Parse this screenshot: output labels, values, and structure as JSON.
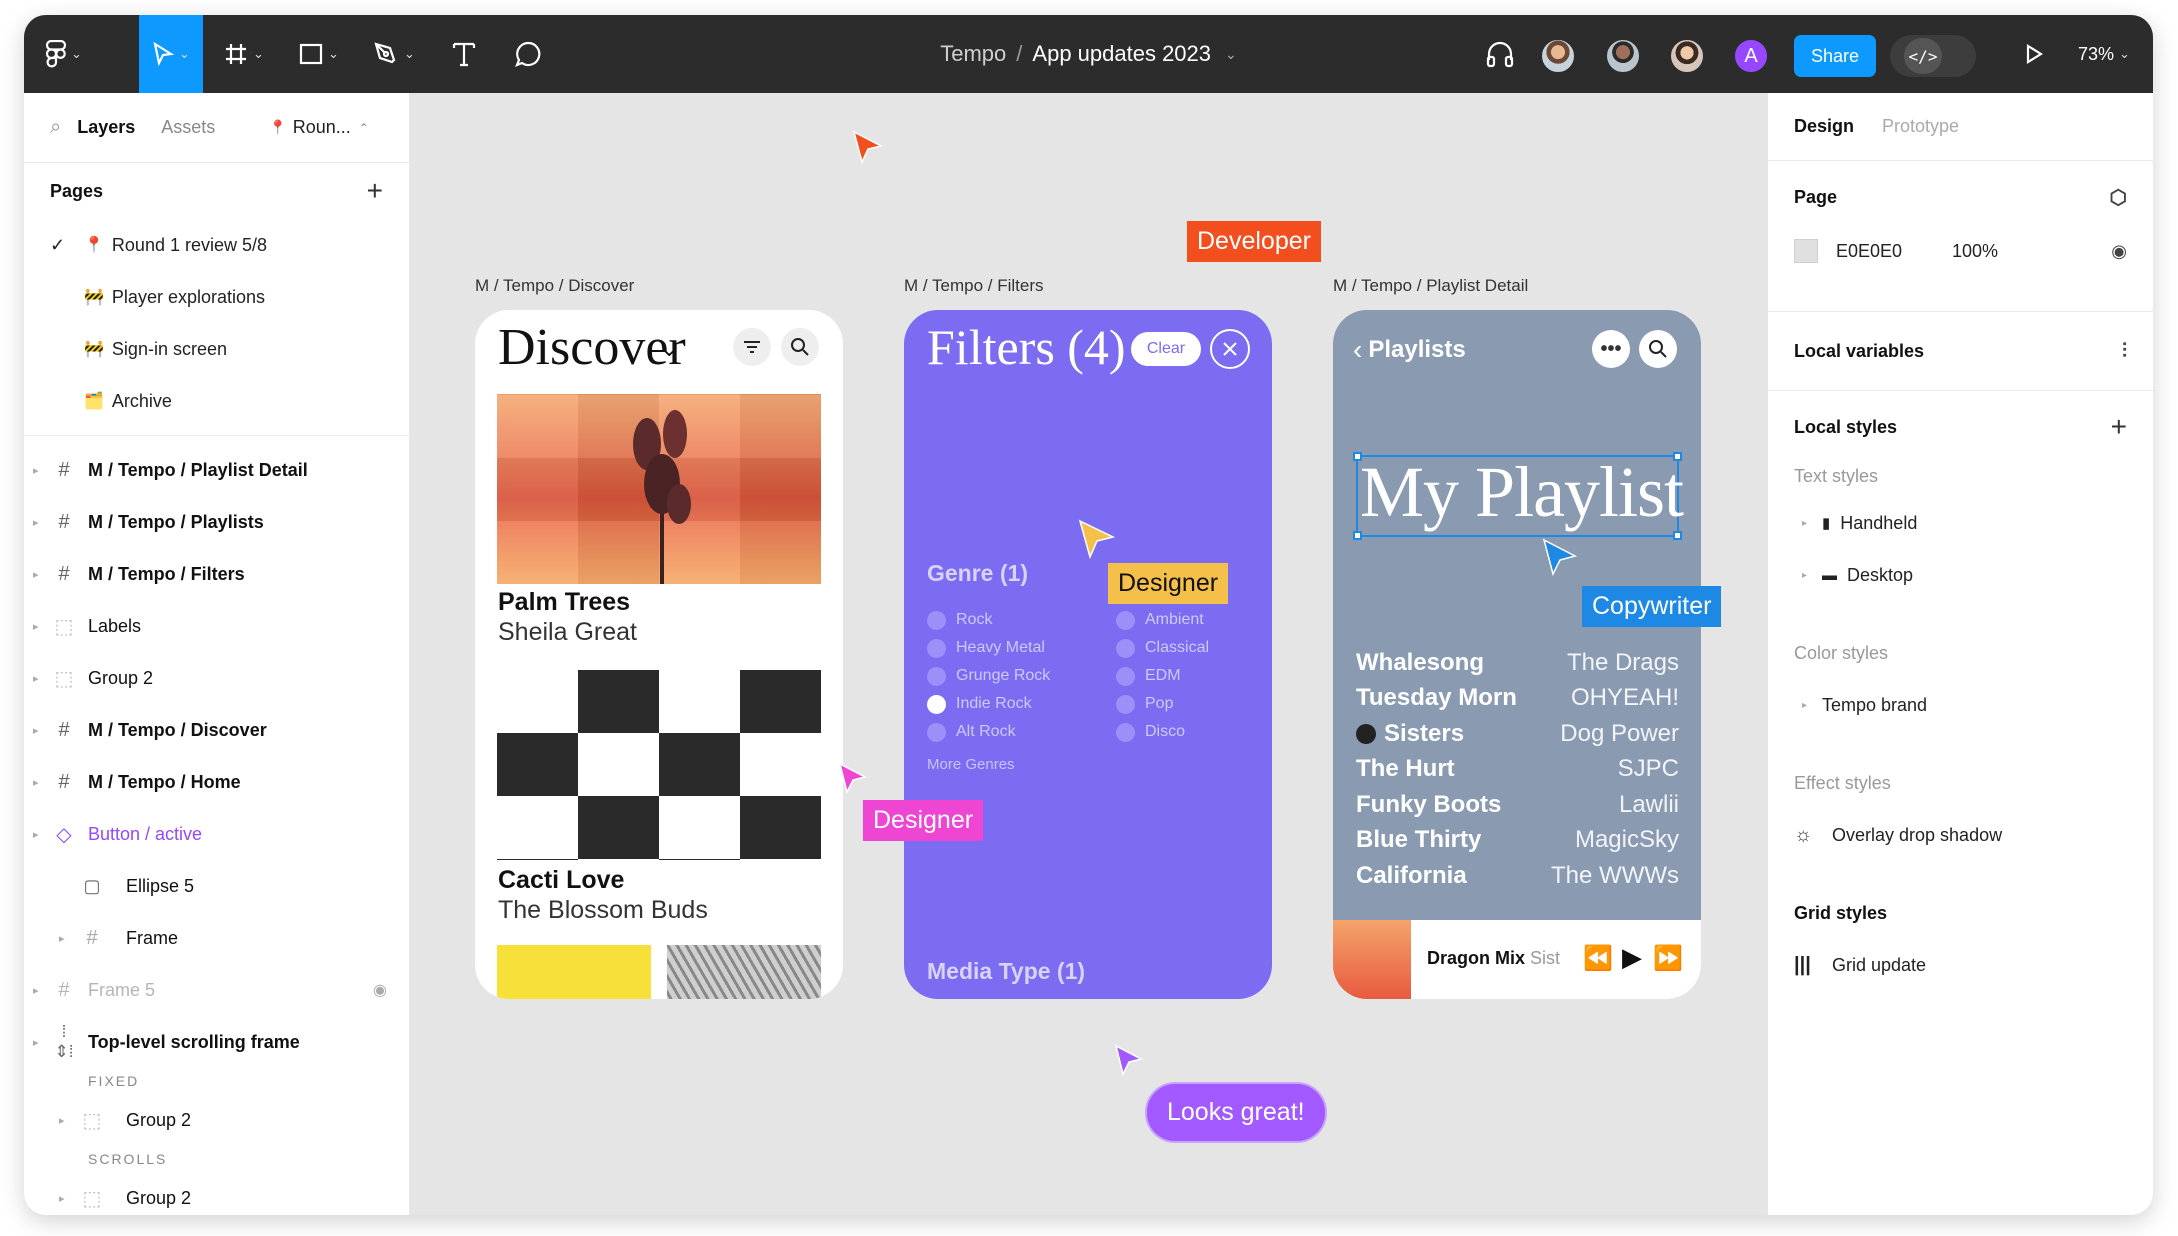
{
  "toolbar": {
    "project": "Tempo",
    "separator": "/",
    "file": "App updates 2023",
    "avatar_letter": "A",
    "share_label": "Share",
    "dev_mode_glyph": "</>",
    "zoom": "73%"
  },
  "left_panel": {
    "tabs": [
      "Layers",
      "Assets"
    ],
    "current_page_short": "Roun...",
    "pages_heading": "Pages",
    "pages": [
      {
        "emoji": "📍",
        "label": "Round 1 review 5/8"
      },
      {
        "emoji": "🚧",
        "label": "Player explorations"
      },
      {
        "emoji": "🚧",
        "label": "Sign-in screen"
      },
      {
        "emoji": "🗂️",
        "label": "Archive"
      }
    ],
    "layers": [
      {
        "label": "M / Tempo / Playlist Detail",
        "icon": "frame-icon"
      },
      {
        "label": "M / Tempo / Playlists",
        "icon": "frame-icon"
      },
      {
        "label": "M / Tempo / Filters",
        "icon": "frame-icon"
      },
      {
        "label": "Labels",
        "icon": "group-icon"
      },
      {
        "label": "Group 2",
        "icon": "group-icon"
      },
      {
        "label": "M / Tempo / Discover",
        "icon": "frame-icon"
      },
      {
        "label": "M / Tempo / Home",
        "icon": "frame-icon"
      },
      {
        "label": "Button / active",
        "icon": "component-instance-icon"
      },
      {
        "label": "Ellipse 5",
        "icon": "ellipse-icon"
      },
      {
        "label": "Frame",
        "icon": "frame-icon"
      },
      {
        "label": "Frame 5",
        "icon": "frame-icon"
      },
      {
        "label": "Top-level scrolling frame",
        "icon": "scroll-frame-icon"
      }
    ],
    "fixed_label": "FIXED",
    "fixed_child": "Group 2",
    "scrolls_label": "SCROLLS",
    "scrolls_child": "Group 2"
  },
  "right_panel": {
    "tabs": [
      "Design",
      "Prototype"
    ],
    "page_heading": "Page",
    "page_color": "E0E0E0",
    "page_opacity": "100%",
    "local_variables": "Local variables",
    "local_styles": "Local styles",
    "text_styles_heading": "Text styles",
    "text_styles": [
      "Handheld",
      "Desktop"
    ],
    "color_styles_heading": "Color styles",
    "color_styles": [
      "Tempo brand"
    ],
    "effect_styles_heading": "Effect styles",
    "effect_styles": [
      "Overlay drop shadow"
    ],
    "grid_styles_heading": "Grid styles",
    "grid_styles": [
      "Grid update"
    ]
  },
  "canvas": {
    "frames": {
      "discover": {
        "label": "M / Tempo / Discover",
        "title": "Discover",
        "card1_title": "Palm Trees",
        "card1_artist": "Sheila Great",
        "card2_title": "Cacti Love",
        "card2_artist": "The Blossom Buds"
      },
      "filters": {
        "label": "M / Tempo / Filters",
        "title": "Filters (4)",
        "clear_label": "Clear",
        "genre_heading": "Genre (1)",
        "genres_left": [
          "Rock",
          "Heavy Metal",
          "Grunge Rock",
          "Indie Rock",
          "Alt Rock"
        ],
        "genres_right": [
          "Ambient",
          "Classical",
          "EDM",
          "Pop",
          "Disco"
        ],
        "selected_genre": "Indie Rock",
        "more_genres": "More Genres",
        "media_type": "Media Type (1)"
      },
      "playlist": {
        "label": "M / Tempo / Playlist Detail",
        "back_label": "Playlists",
        "title": "My Playlist",
        "tracks": [
          {
            "title": "Whalesong",
            "artist": "The Drags"
          },
          {
            "title": "Tuesday Morn",
            "artist": "OHYEAH!"
          },
          {
            "title": "Sisters",
            "artist": "Dog Power"
          },
          {
            "title": "The Hurt",
            "artist": "SJPC"
          },
          {
            "title": "Funky Boots",
            "artist": "Lawlii"
          },
          {
            "title": "Blue Thirty",
            "artist": "MagicSky"
          },
          {
            "title": "California",
            "artist": "The WWWs"
          }
        ],
        "now_playing": "Dragon Mix",
        "now_playing_artist": "Sist"
      }
    },
    "cursors": {
      "developer": {
        "label": "Developer",
        "color": "#f24e1e"
      },
      "designer_yellow": {
        "label": "Designer",
        "color": "#f5c04a"
      },
      "copywriter": {
        "label": "Copywriter",
        "color": "#1e88e5"
      },
      "designer_pink": {
        "label": "Designer",
        "color": "#ee46d3"
      },
      "comment": {
        "label": "Looks great!",
        "color": "#a259ff"
      }
    }
  },
  "colors": {
    "accent": "#0d99ff",
    "toolbar": "#2c2c2c",
    "filters_bg": "#7b6cf2",
    "playlist_bg": "#8a9ab1",
    "component": "#9747ff"
  }
}
